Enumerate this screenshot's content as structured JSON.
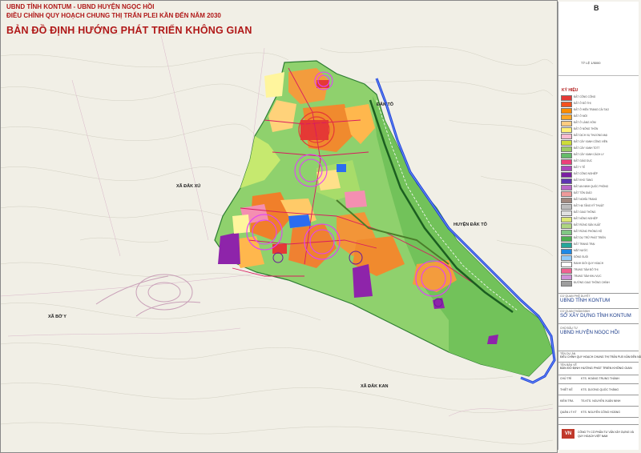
{
  "header": {
    "line1": "UBND TỈNH KONTUM - UBND HUYỆN NGỌC HỒI",
    "line2": "ĐIỀU CHỈNH QUY HOẠCH CHUNG THỊ TRẤN PLEI KẦN ĐẾN NĂM 2030",
    "title": "BẢN ĐỒ ĐỊNH HƯỚNG PHÁT TRIỂN KHÔNG GIAN"
  },
  "map_labels": {
    "dak_to_top": "ĐẮK TÔ",
    "huyen_dak_to": "HUYỆN ĐẮK TÔ",
    "xa_bo_y": "XÃ BỜ Y",
    "xa_dak_kan": "XÃ ĐẮK KAN",
    "xa_dak_xu": "XÃ ĐẮK XÚ"
  },
  "north": {
    "letter": "B",
    "caption": "TỶ LỆ 1/5000"
  },
  "legend": {
    "title": "KÝ HIỆU",
    "items": [
      {
        "color": "#e53935",
        "label": "ĐẤT CÔNG CỘNG"
      },
      {
        "color": "#f4511e",
        "label": "ĐẤT Ở ĐÔ THỊ"
      },
      {
        "color": "#fb8c00",
        "label": "ĐẤT Ở HIỆN TRẠNG CẢI TẠO"
      },
      {
        "color": "#ffa726",
        "label": "ĐẤT Ở MỚI"
      },
      {
        "color": "#ffcc80",
        "label": "ĐẤT Ở LÀNG XÓM"
      },
      {
        "color": "#fff176",
        "label": "ĐẤT Ở NÔNG THÔN"
      },
      {
        "color": "#f8bbd0",
        "label": "ĐẤT DỊCH VỤ THƯƠNG MẠI"
      },
      {
        "color": "#cddc39",
        "label": "ĐẤT CÂY XANH CÔNG VIÊN"
      },
      {
        "color": "#9ccc65",
        "label": "ĐẤT CÂY XANH TDTT"
      },
      {
        "color": "#66bb6a",
        "label": "ĐẤT CÂY XANH CÁCH LY"
      },
      {
        "color": "#ec407a",
        "label": "ĐẤT GIÁO DỤC"
      },
      {
        "color": "#ab47bc",
        "label": "ĐẤT Y TẾ"
      },
      {
        "color": "#7b1fa2",
        "label": "ĐẤT CÔNG NGHIỆP"
      },
      {
        "color": "#5e35b1",
        "label": "ĐẤT KHO TÀNG"
      },
      {
        "color": "#ba68c8",
        "label": "ĐẤT AN NINH QUỐC PHÒNG"
      },
      {
        "color": "#ef9a9a",
        "label": "ĐẤT TÔN GIÁO"
      },
      {
        "color": "#a1887f",
        "label": "ĐẤT NGHĨA TRANG"
      },
      {
        "color": "#bdbdbd",
        "label": "ĐẤT HẠ TẦNG KỸ THUẬT"
      },
      {
        "color": "#e0e0e0",
        "label": "ĐẤT GIAO THÔNG"
      },
      {
        "color": "#dce775",
        "label": "ĐẤT NÔNG NGHIỆP"
      },
      {
        "color": "#aed581",
        "label": "ĐẤT RỪNG SẢN XUẤT"
      },
      {
        "color": "#81c784",
        "label": "ĐẤT RỪNG PHÒNG HỘ"
      },
      {
        "color": "#4caf50",
        "label": "ĐẤT DỰ TRỮ PHÁT TRIỂN"
      },
      {
        "color": "#26a69a",
        "label": "ĐẤT TRANG TRẠI"
      },
      {
        "color": "#1e88e5",
        "label": "MẶT NƯỚC"
      },
      {
        "color": "#90caf9",
        "label": "SÔNG SUỐI"
      },
      {
        "color": "#ffffff",
        "label": "RANH GIỚI QUY HOẠCH"
      },
      {
        "color": "#f06292",
        "label": "TRUNG TÂM ĐÔ THỊ"
      },
      {
        "color": "#ce93d8",
        "label": "TRUNG TÂM KHU VỰC"
      },
      {
        "color": "#9e9e9e",
        "label": "ĐƯỜNG GIAO THÔNG CHÍNH"
      }
    ]
  },
  "titleblock": {
    "approve_cap": "CƠ QUAN PHÊ DUYỆT",
    "approve_org": "UBND TỈNH KONTUM",
    "appraise_cap": "CƠ QUAN THẨM ĐỊNH",
    "appraise_org": "SỞ XÂY DỰNG TỈNH KONTUM",
    "owner_cap": "CHỦ ĐẦU TƯ",
    "owner_org": "UBND HUYỆN NGỌC HỒI",
    "project_cap": "TÊN DỰ ÁN",
    "project_name": "ĐIỀU CHỈNH QUY HOẠCH CHUNG THỊ TRẤN PLEI KẦN ĐẾN NĂM 2030",
    "drawing_cap": "TÊN BẢN VẼ",
    "drawing_name": "BẢN ĐỒ ĐỊNH HƯỚNG PHÁT TRIỂN KHÔNG GIAN",
    "staff": [
      {
        "role": "CHỦ TRÌ",
        "name": "KTS. HOÀNG TRUNG THÀNH"
      },
      {
        "role": "THIẾT KẾ",
        "name": "KTS. DƯƠNG QUỐC THẮNG"
      },
      {
        "role": "KIỂM TRA",
        "name": "TS.KTS. NGUYỄN XUÂN NINH"
      },
      {
        "role": "QUẢN LÝ KT",
        "name": "KTS. NGUYỄN CÔNG HOÀNG"
      }
    ],
    "company": "CÔNG TY CỔ PHẦN TƯ VẤN XÂY DỰNG VÀ QUY HOẠCH VIỆT NAM",
    "logo_text": "VN"
  }
}
